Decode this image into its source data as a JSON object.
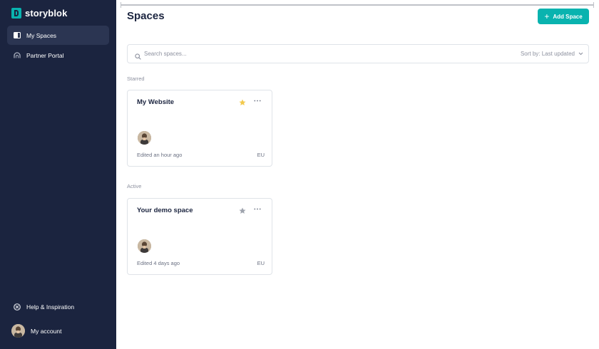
{
  "brand": {
    "name": "storyblok",
    "accent": "#09b3af",
    "sidebar_bg": "#1b243f"
  },
  "sidebar": {
    "items": [
      {
        "label": "My Spaces",
        "icon": "spaces-icon",
        "active": true
      },
      {
        "label": "Partner Portal",
        "icon": "partner-portal-icon",
        "active": false
      }
    ],
    "bottom": [
      {
        "label": "Help & Inspiration",
        "icon": "help-icon"
      },
      {
        "label": "My account",
        "icon": "avatar"
      }
    ]
  },
  "header": {
    "title": "Spaces",
    "add_button": "Add Space"
  },
  "search": {
    "placeholder": "Search spaces...",
    "sort_label": "Sort by: Last updated"
  },
  "sections": [
    {
      "label": "Starred",
      "cards": [
        {
          "title": "My Website",
          "starred": true,
          "edited": "Edited an hour ago",
          "region": "EU"
        }
      ]
    },
    {
      "label": "Active",
      "cards": [
        {
          "title": "Your demo space",
          "starred": false,
          "edited": "Edited 4 days ago",
          "region": "EU"
        }
      ]
    }
  ],
  "colors": {
    "star_active": "#f2c94c",
    "star_inactive": "#9ea3ad"
  }
}
